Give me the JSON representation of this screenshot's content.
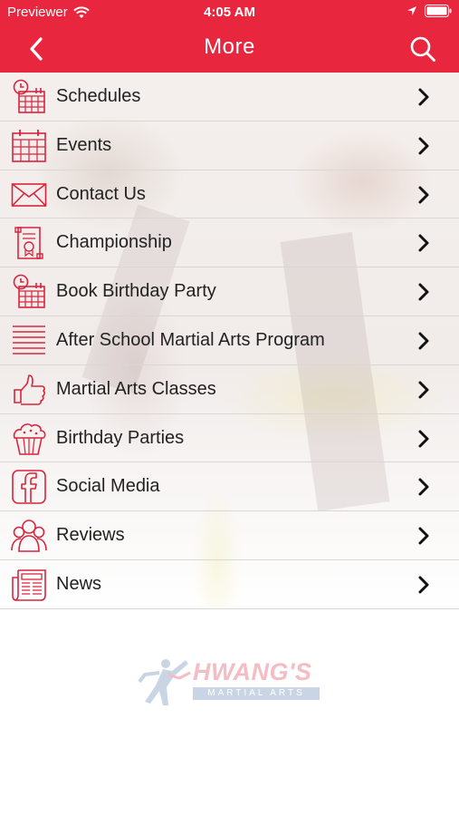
{
  "status_bar": {
    "carrier": "Previewer",
    "time": "4:05 AM"
  },
  "nav": {
    "title": "More"
  },
  "menu": {
    "items": [
      {
        "label": "Schedules",
        "icon": "calendar-clock-icon"
      },
      {
        "label": "Events",
        "icon": "calendar-icon"
      },
      {
        "label": "Contact Us",
        "icon": "envelope-icon"
      },
      {
        "label": "Championship",
        "icon": "certificate-icon"
      },
      {
        "label": "Book Birthday Party",
        "icon": "calendar-clock-icon"
      },
      {
        "label": "After School Martial Arts Program",
        "icon": "list-lines-icon"
      },
      {
        "label": "Martial Arts Classes",
        "icon": "thumbs-up-icon"
      },
      {
        "label": "Birthday Parties",
        "icon": "cupcake-icon"
      },
      {
        "label": "Social Media",
        "icon": "facebook-icon"
      },
      {
        "label": "Reviews",
        "icon": "people-icon"
      },
      {
        "label": "News",
        "icon": "newspaper-icon"
      }
    ]
  },
  "logo": {
    "name": "HWANG'S",
    "tagline": "MARTIAL ARTS"
  },
  "colors": {
    "accent": "#e8273f",
    "icon": "#d9243d",
    "text": "#222222"
  }
}
